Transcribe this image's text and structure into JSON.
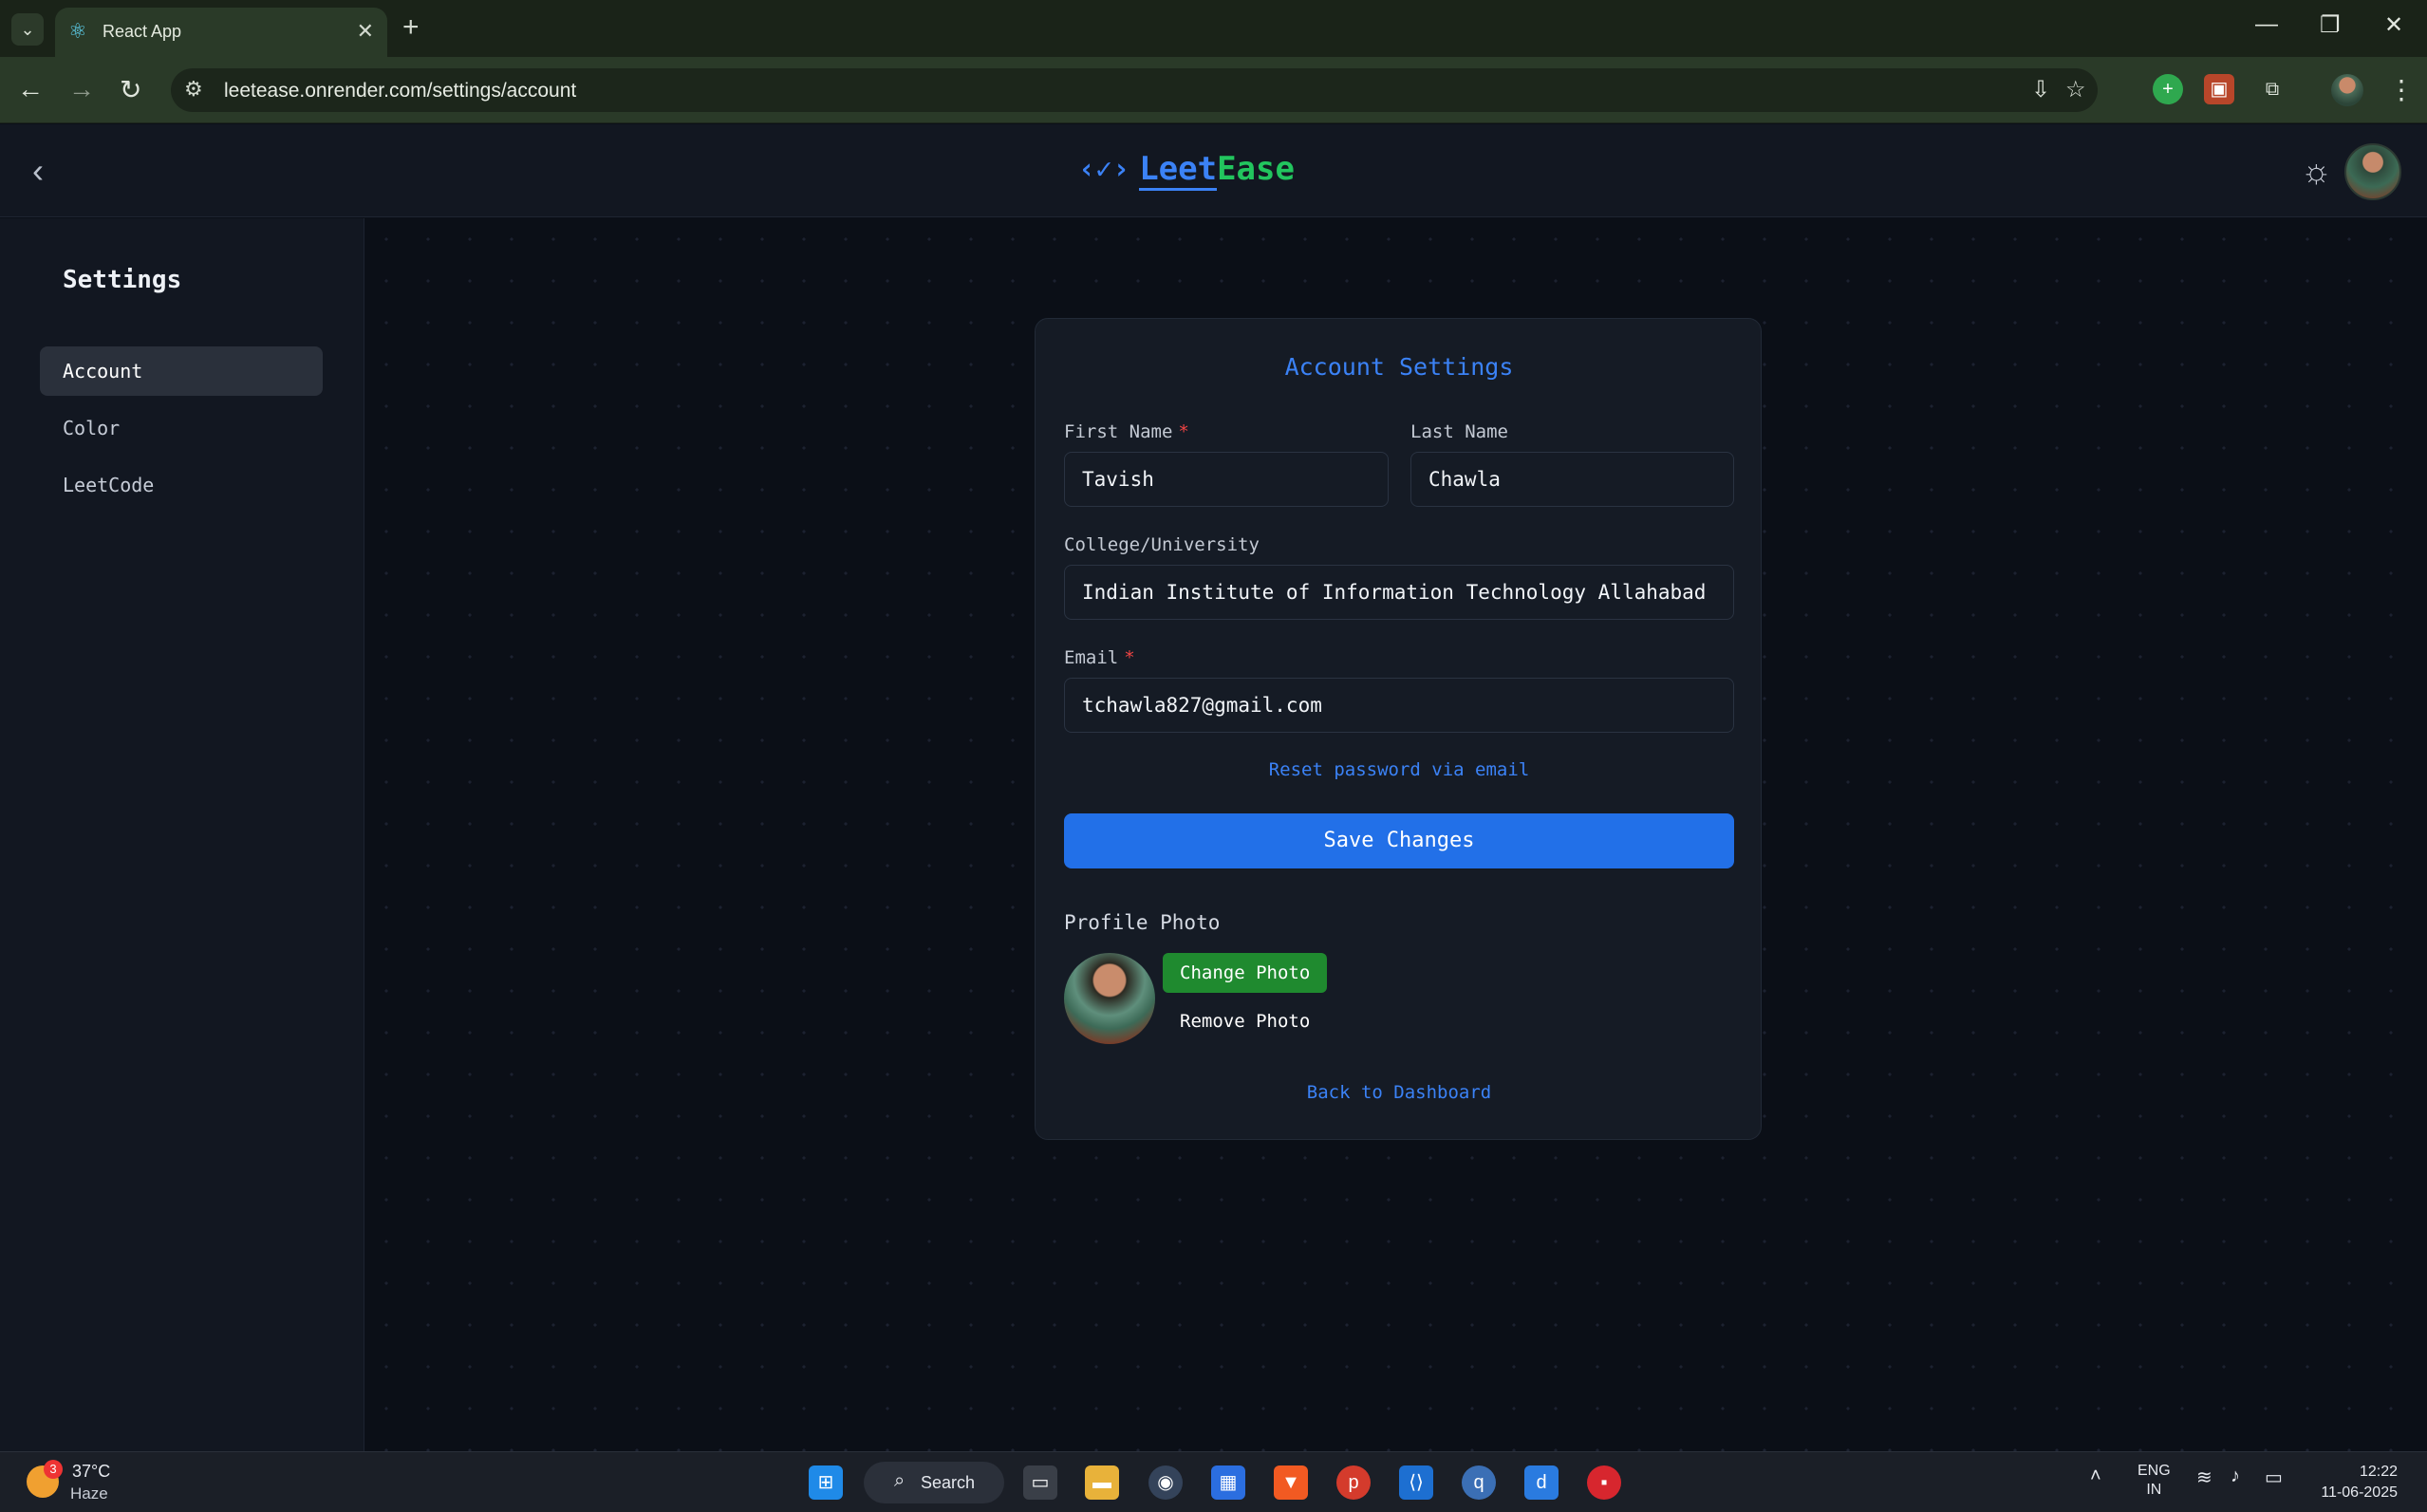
{
  "browser": {
    "tab_title": "React App",
    "url": "leetease.onrender.com/settings/account",
    "newtab_symbol": "+",
    "dropdown_symbol": "⌄"
  },
  "app": {
    "logo_mark": "‹✓›",
    "logo_part1": "Leet",
    "logo_part2": "Ease",
    "accent_blue": "#3b82f6",
    "accent_green": "#22c55e"
  },
  "sidebar": {
    "title": "Settings",
    "items": [
      {
        "label": "Account",
        "active": true
      },
      {
        "label": "Color",
        "active": false
      },
      {
        "label": "LeetCode",
        "active": false
      }
    ]
  },
  "form": {
    "title": "Account Settings",
    "first_name_label": "First Name",
    "first_name_value": "Tavish",
    "last_name_label": "Last Name",
    "last_name_value": "Chawla",
    "college_label": "College/University",
    "college_value": "Indian Institute of Information Technology Allahabad",
    "email_label": "Email",
    "email_value": "tchawla827@gmail.com",
    "required_marker": "*",
    "reset_link": "Reset password via email",
    "save_button": "Save Changes",
    "profile_photo_title": "Profile Photo",
    "change_photo": "Change Photo",
    "remove_photo": "Remove Photo",
    "back_link": "Back to Dashboard"
  },
  "taskbar": {
    "weather_badge": "3",
    "temperature": "37°C",
    "condition": "Haze",
    "search_label": "Search",
    "lang_line1": "ENG",
    "lang_line2": "IN",
    "time": "12:22",
    "date": "11-06-2025"
  }
}
